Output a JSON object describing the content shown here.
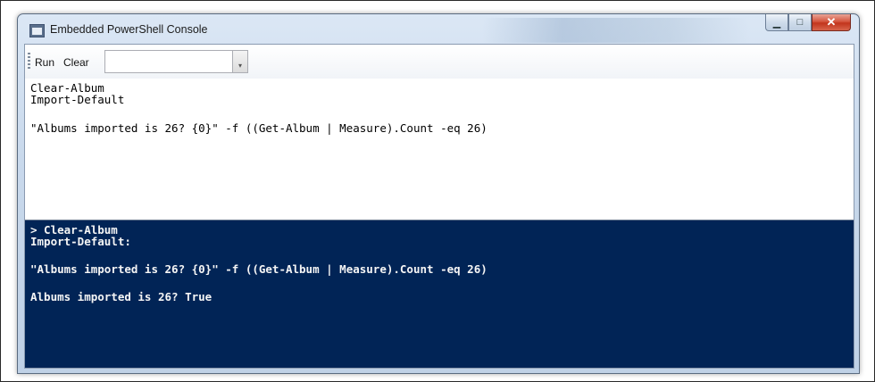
{
  "window": {
    "title": "Embedded PowerShell Console",
    "minimize_glyph": "▁",
    "maximize_glyph": "□",
    "close_glyph": "✕"
  },
  "toolbar": {
    "run_label": "Run",
    "clear_label": "Clear",
    "input_value": "",
    "dropdown_glyph": "▾"
  },
  "editor": {
    "lines": [
      "Clear-Album",
      "Import-Default",
      "",
      "\"Albums imported is 26? {0}\" -f ((Get-Album | Measure).Count -eq 26)"
    ]
  },
  "console": {
    "lines": [
      "> Clear-Album",
      "Import-Default:",
      "",
      "\"Albums imported is 26? {0}\" -f ((Get-Album | Measure).Count -eq 26)",
      "",
      "Albums imported is 26? True"
    ]
  },
  "colors": {
    "console_background": "#012456",
    "console_text": "#f5f5f5",
    "editor_background": "#ffffff",
    "close_button": "#c2351c"
  }
}
